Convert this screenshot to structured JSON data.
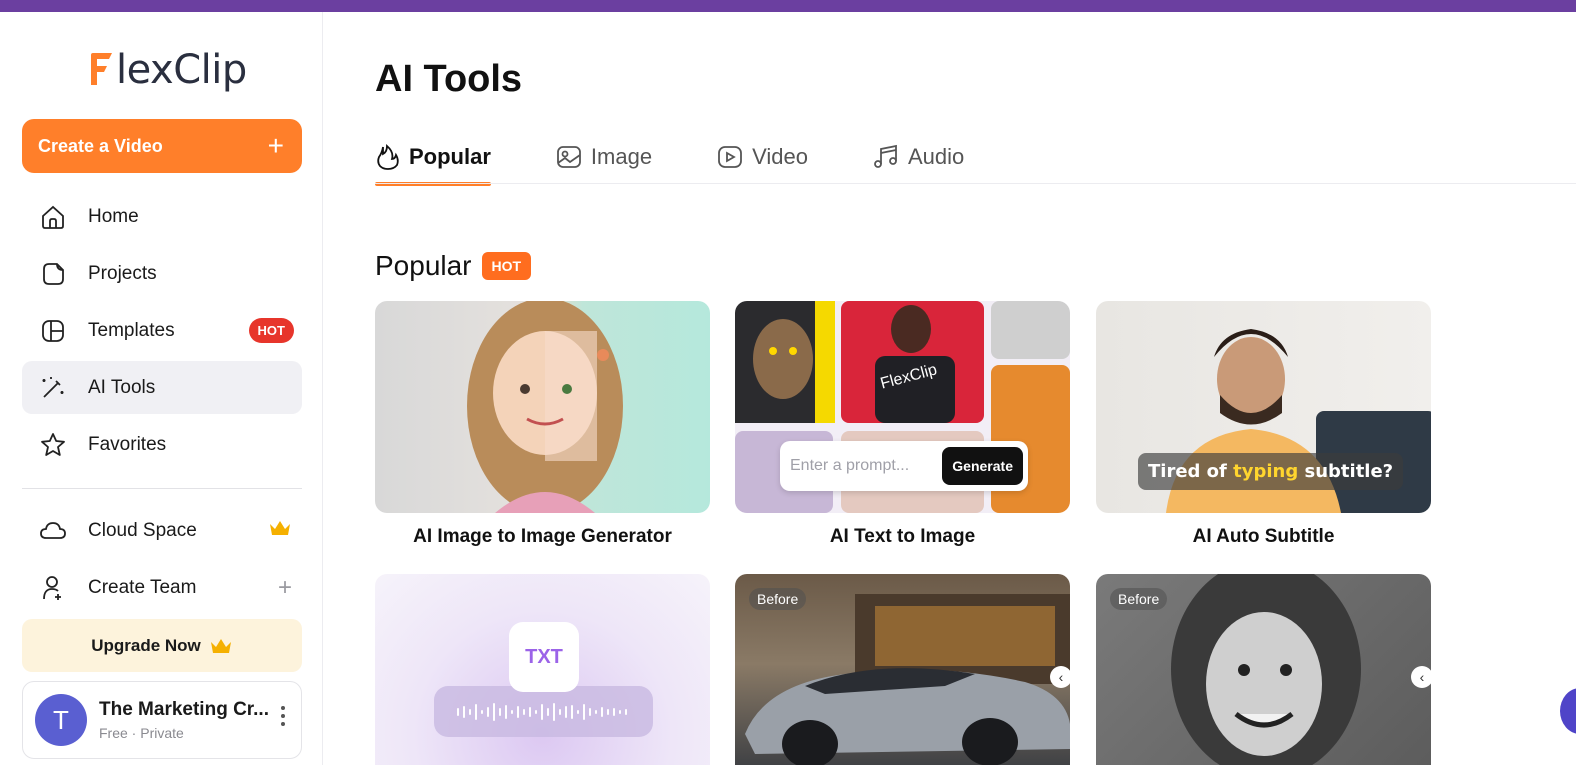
{
  "brand": {
    "name": "lexClip",
    "accent": "#ff7f2a",
    "top_bar_color": "#6b3fa0"
  },
  "sidebar": {
    "create_button": {
      "label": "Create a Video",
      "icon": "plus-icon"
    },
    "items": [
      {
        "label": "Home",
        "icon": "home-icon"
      },
      {
        "label": "Projects",
        "icon": "projects-icon"
      },
      {
        "label": "Templates",
        "icon": "templates-icon",
        "badge": "HOT"
      },
      {
        "label": "AI Tools",
        "icon": "magic-wand-icon",
        "active": true
      },
      {
        "label": "Favorites",
        "icon": "star-icon"
      }
    ],
    "secondary_items": [
      {
        "label": "Cloud Space",
        "icon": "cloud-icon",
        "trailing": "crown-icon"
      },
      {
        "label": "Create Team",
        "icon": "add-user-icon",
        "trailing": "+"
      }
    ],
    "upgrade_label": "Upgrade Now",
    "account": {
      "avatar_letter": "T",
      "name": "The Marketing Cr...",
      "plan": "Free · Private"
    }
  },
  "main": {
    "title": "AI Tools",
    "tabs": [
      {
        "label": "Popular",
        "icon": "fire-icon",
        "active": true
      },
      {
        "label": "Image",
        "icon": "image-icon"
      },
      {
        "label": "Video",
        "icon": "play-icon"
      },
      {
        "label": "Audio",
        "icon": "music-note-icon"
      }
    ],
    "section": {
      "title": "Popular",
      "badge": "HOT"
    },
    "cards": [
      {
        "label": "AI Image to Image Generator"
      },
      {
        "label": "AI Text to Image",
        "prompt_placeholder": "Enter a prompt...",
        "generate_label": "Generate",
        "overlay_text": "FlexClip"
      },
      {
        "label": "AI Auto Subtitle",
        "caption_pre": "Tired of ",
        "caption_hl": "typing",
        "caption_post": " subtitle?"
      }
    ],
    "cards_row2": [
      {
        "file_label": "TXT"
      },
      {
        "tag": "Before"
      },
      {
        "tag": "Before"
      }
    ]
  }
}
